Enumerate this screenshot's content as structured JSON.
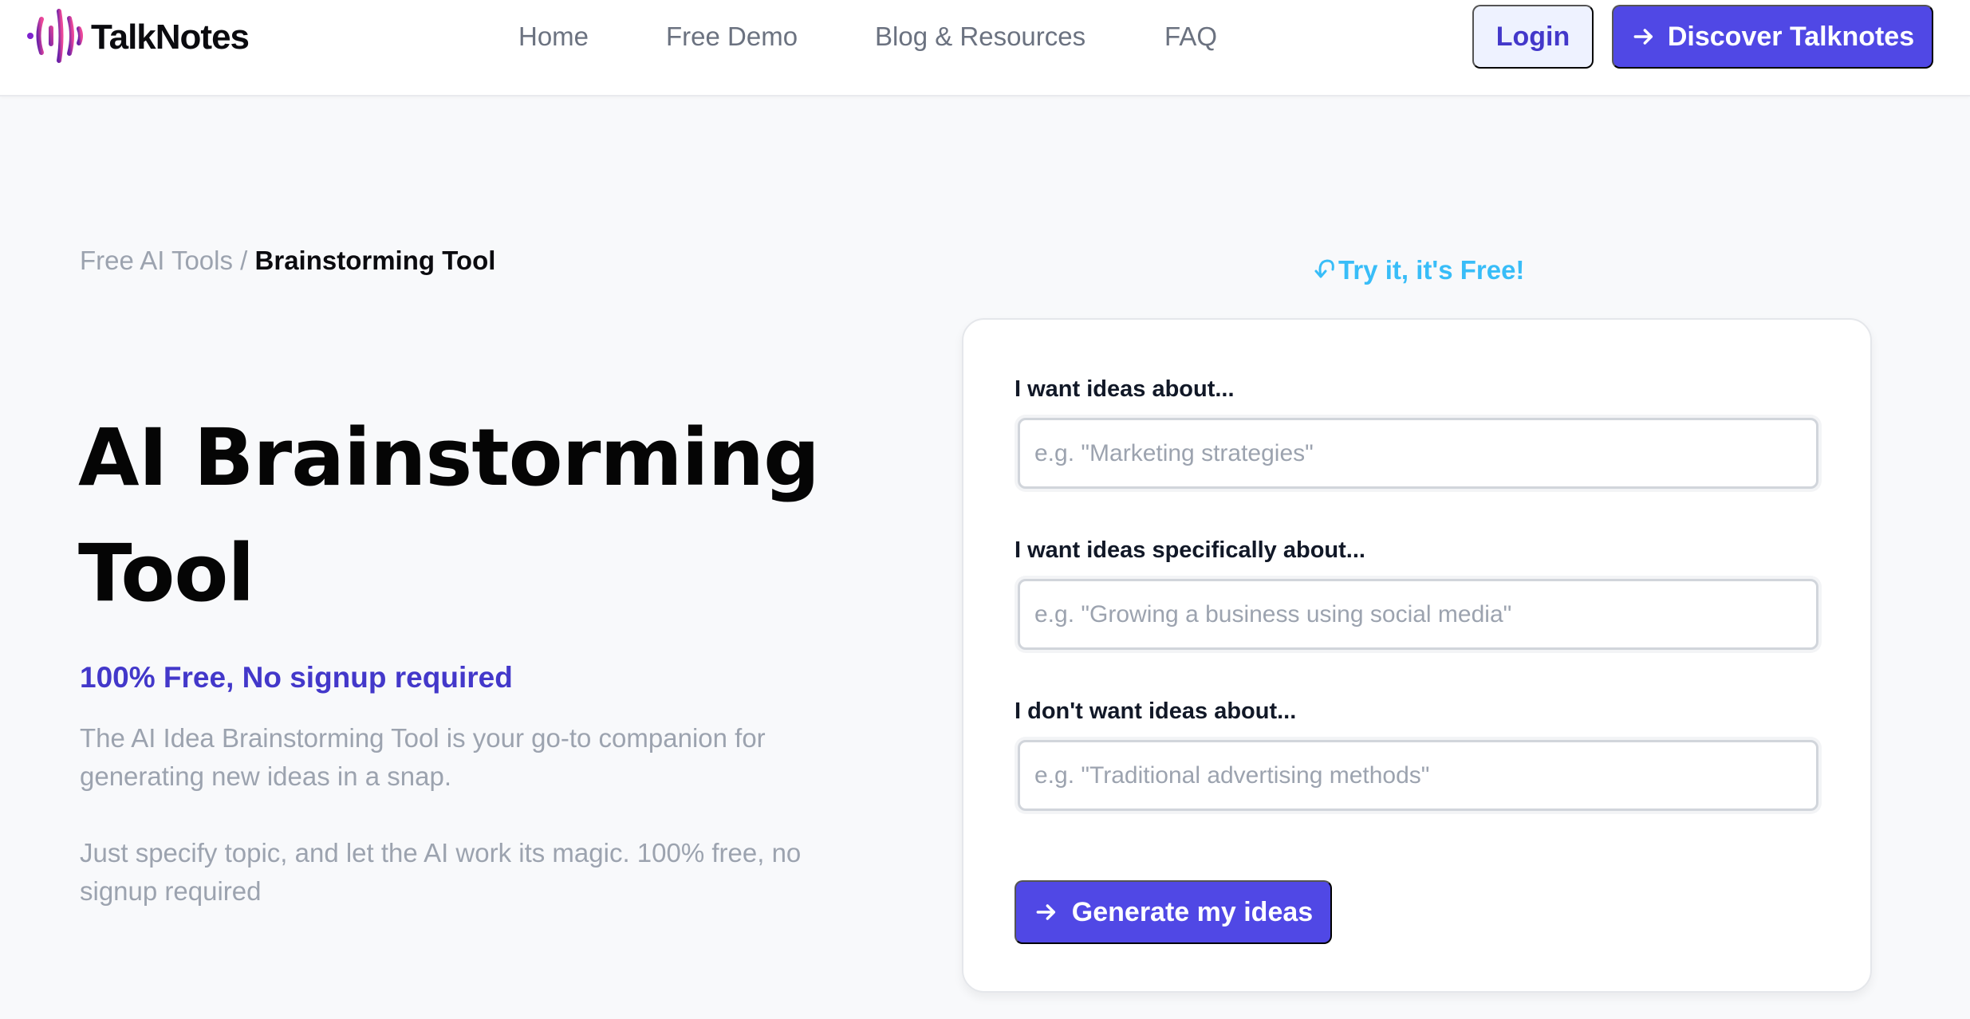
{
  "header": {
    "logo": {
      "icon": "soundwave-logo-icon",
      "text": "TalkNotes",
      "gradient": [
        "#6b21a8",
        "#ec4899"
      ]
    },
    "nav": [
      {
        "label": "Home"
      },
      {
        "label": "Free Demo"
      },
      {
        "label": "Blog & Resources"
      },
      {
        "label": "FAQ"
      }
    ],
    "login_label": "Login",
    "discover_label": "Discover Talknotes",
    "discover_icon": "arrow-right-icon"
  },
  "breadcrumb": {
    "parent": "Free AI Tools",
    "separator": "/",
    "current": "Brainstorming Tool"
  },
  "hero": {
    "title": "AI Brainstorming Tool",
    "subtitle": "100% Free, No signup required",
    "description_1": "The AI Idea Brainstorming Tool is your go-to companion for generating new ideas in a snap.",
    "description_2": "Just specify topic, and let the AI work its magic. 100% free, no signup required"
  },
  "form": {
    "callout": "Try it, it's Free!",
    "callout_icon": "curved-arrow-down-icon",
    "fields": [
      {
        "label": "I want ideas about...",
        "value": "",
        "placeholder": "e.g. \"Marketing strategies\""
      },
      {
        "label": "I want ideas specifically about...",
        "value": "",
        "placeholder": "e.g. \"Growing a business using social media\""
      },
      {
        "label": "I don't want ideas about...",
        "value": "",
        "placeholder": "e.g. \"Traditional advertising methods\""
      }
    ],
    "submit_label": "Generate my ideas",
    "submit_icon": "arrow-right-icon"
  },
  "colors": {
    "primary": "#5048e5",
    "primary_text": "#4338ca",
    "login_bg": "#eef2ff",
    "callout": "#38bdf8",
    "muted": "#9ca3af",
    "nav": "#6b7280"
  }
}
